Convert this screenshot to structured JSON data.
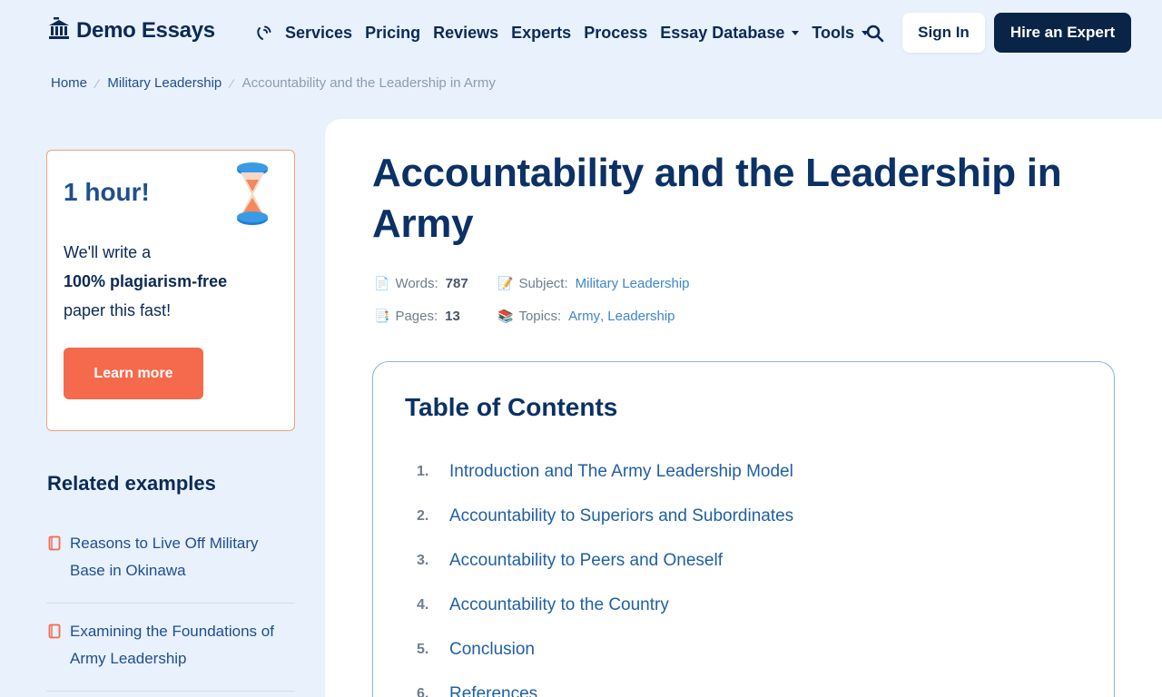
{
  "header": {
    "logo_text": "Demo Essays",
    "nav": [
      {
        "label": "Services"
      },
      {
        "label": "Pricing"
      },
      {
        "label": "Reviews"
      },
      {
        "label": "Experts"
      },
      {
        "label": "Process"
      },
      {
        "label": "Essay Database",
        "dropdown": true
      },
      {
        "label": "Tools",
        "dropdown": true
      }
    ],
    "sign_in": "Sign In",
    "hire": "Hire an Expert"
  },
  "breadcrumb": {
    "home": "Home",
    "category": "Military Leadership",
    "current": "Accountability and the Leadership in Army",
    "separator": "⁄"
  },
  "promo": {
    "title": "1 hour!",
    "line1": "We'll write a",
    "line2": "100% plagiarism-free",
    "line3": "paper this fast!",
    "button": "Learn more"
  },
  "related": {
    "heading": "Related examples",
    "items": [
      {
        "title": "Reasons to Live Off Military Base in Okinawa"
      },
      {
        "title": "Examining the Foundations of Army Leadership"
      }
    ]
  },
  "article": {
    "title": "Accountability and the Leadership in Army",
    "words_label": "Words:",
    "words_value": "787",
    "pages_label": "Pages:",
    "pages_value": "13",
    "subject_label": "Subject:",
    "subject_value": "Military Leadership",
    "topics_label": "Topics:",
    "topic1": "Army",
    "topic_sep": ",",
    "topic2": "Leadership"
  },
  "toc": {
    "title": "Table of Contents",
    "items": [
      {
        "num": "1.",
        "label": "Introduction and The Army Leadership Model"
      },
      {
        "num": "2.",
        "label": "Accountability to Superiors and Subordinates"
      },
      {
        "num": "3.",
        "label": "Accountability to Peers and Oneself"
      },
      {
        "num": "4.",
        "label": "Accountability to the Country"
      },
      {
        "num": "5.",
        "label": "Conclusion"
      },
      {
        "num": "6.",
        "label": "References"
      }
    ]
  },
  "colors": {
    "background": "#e8f1fc",
    "navy": "#0b2a55",
    "accent_orange": "#f56a4c",
    "link_blue": "#1f5fa4"
  },
  "icons": [
    "logo-building-icon",
    "phone-icon",
    "search-icon",
    "hourglass-icon",
    "document-icon",
    "book-icon"
  ]
}
